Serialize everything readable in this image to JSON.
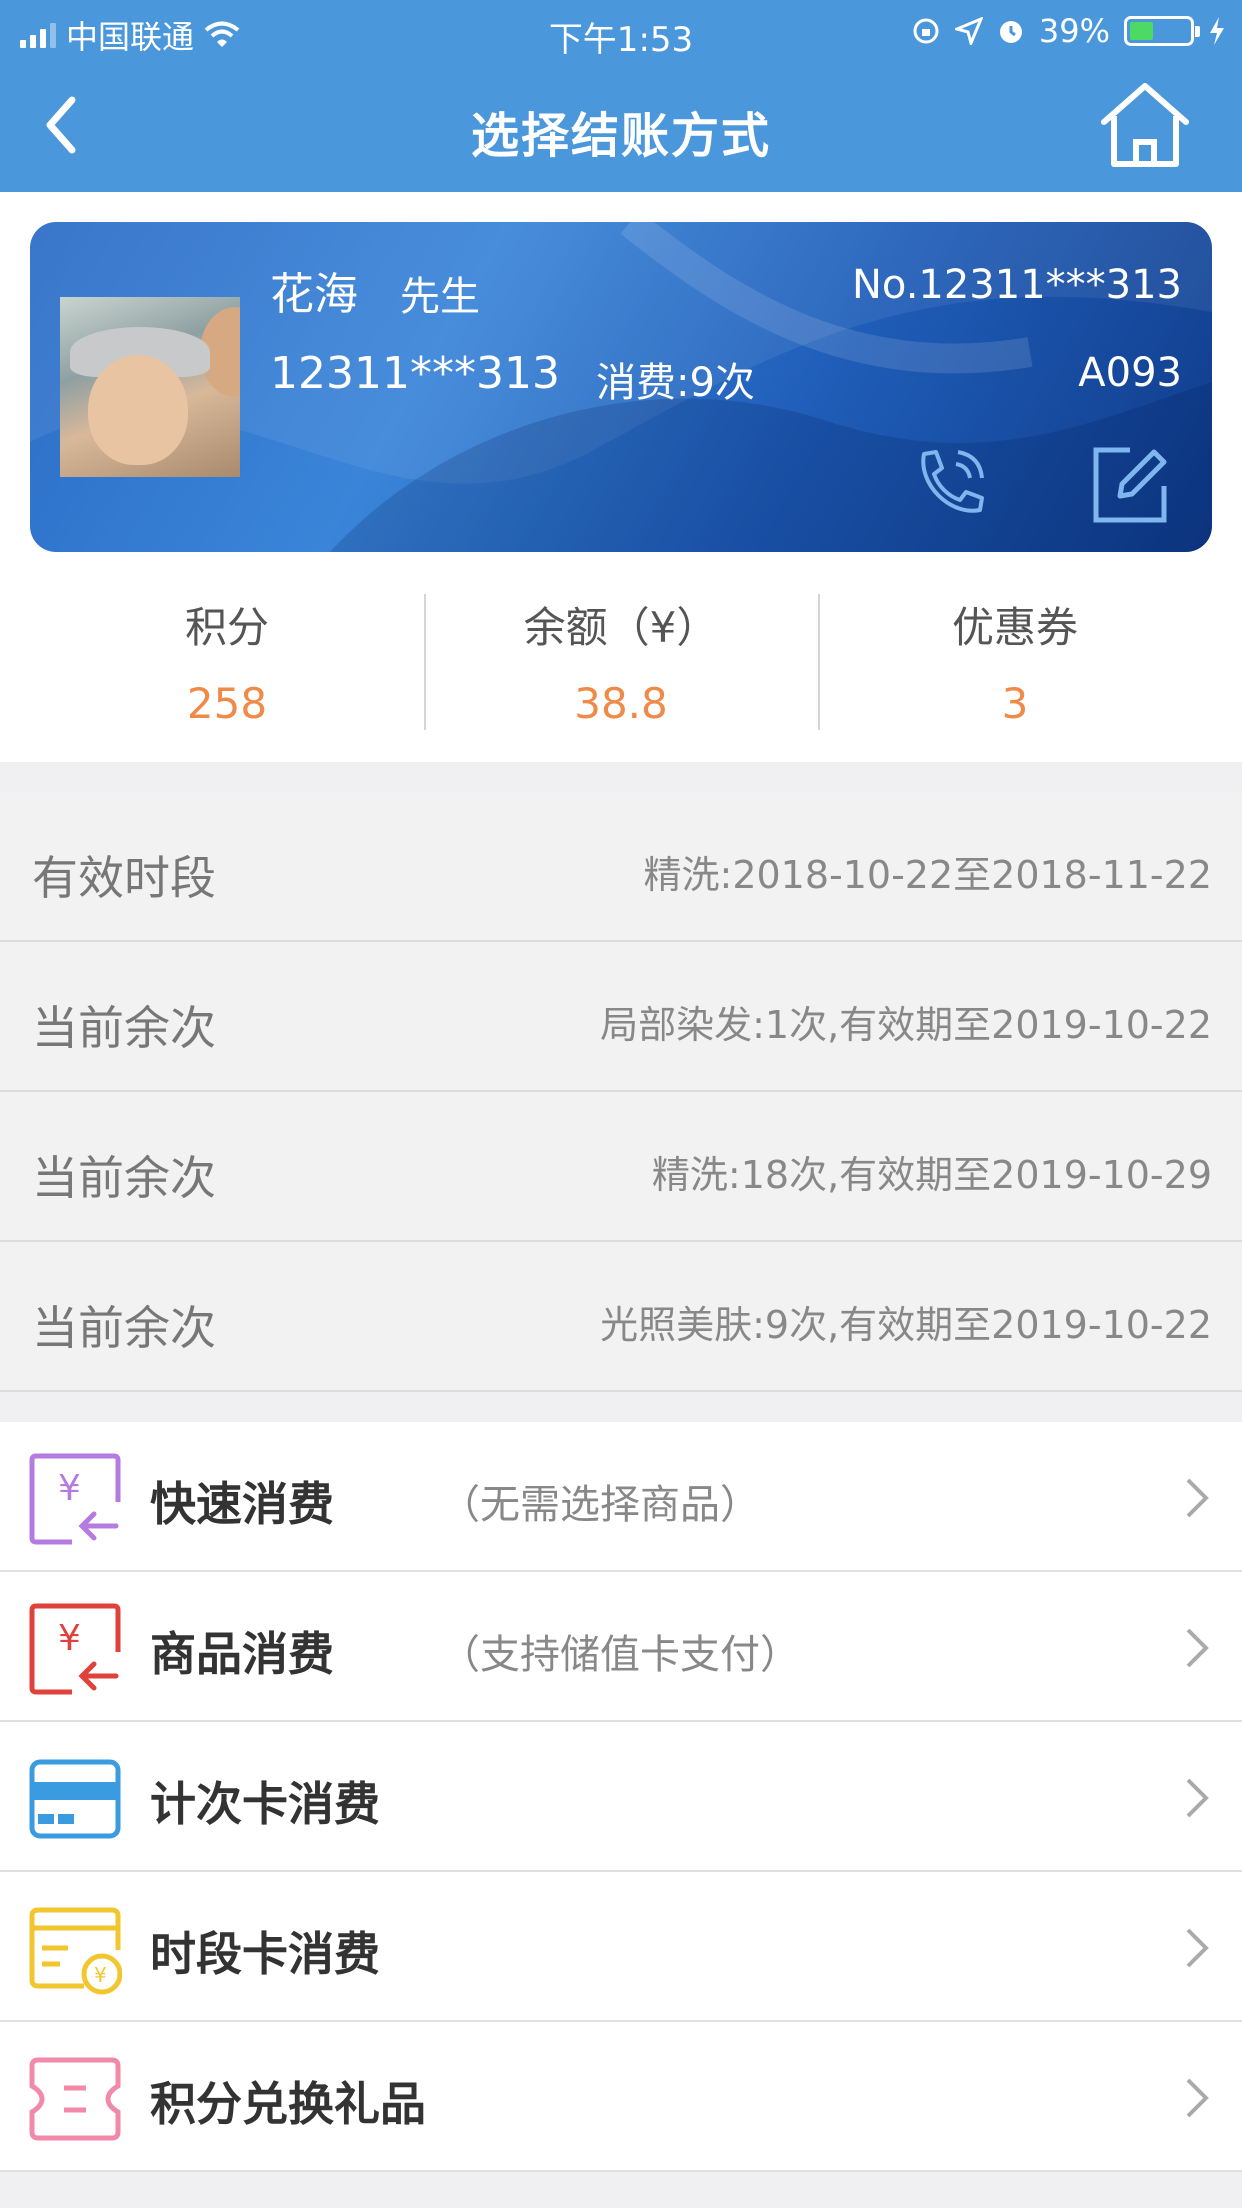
{
  "status": {
    "carrier": "中国联通",
    "time": "下午1:53",
    "battery": "39%",
    "battery_level": 0.39
  },
  "nav": {
    "title": "选择结账方式",
    "back_icon": "chevron-left-icon",
    "home_icon": "home-icon"
  },
  "member": {
    "name": "花海",
    "gender": "先生",
    "card_no": "No.12311***313",
    "phone": "12311***313",
    "visits": "消费:9次",
    "code": "A093"
  },
  "stats": [
    {
      "label": "积分",
      "value": "258"
    },
    {
      "label": "余额（¥）",
      "value": "38.8"
    },
    {
      "label": "优惠券",
      "value": "3"
    }
  ],
  "info_rows": [
    {
      "key": "有效时段",
      "value": "精洗:2018-10-22至2018-11-22"
    },
    {
      "key": "当前余次",
      "value": "局部染发:1次,有效期至2019-10-22"
    },
    {
      "key": "当前余次",
      "value": "精洗:18次,有效期至2019-10-29"
    },
    {
      "key": "当前余次",
      "value": "光照美肤:9次,有效期至2019-10-22"
    }
  ],
  "menu": [
    {
      "label": "快速消费",
      "sub": "（无需选择商品）",
      "icon": "quick-pay-icon",
      "color": "#b57be0"
    },
    {
      "label": "商品消费",
      "sub": "（支持储值卡支付）",
      "icon": "product-pay-icon",
      "color": "#e0413a"
    },
    {
      "label": "计次卡消费",
      "sub": "",
      "icon": "count-card-icon",
      "color": "#3a9be0"
    },
    {
      "label": "时段卡消费",
      "sub": "",
      "icon": "period-card-icon",
      "color": "#f2c62e"
    },
    {
      "label": "积分兑换礼品",
      "sub": "",
      "icon": "gift-exchange-icon",
      "color": "#f08aa8"
    }
  ],
  "colors": {
    "nav_bg": "#4a97dc",
    "accent_orange": "#f08a49"
  }
}
